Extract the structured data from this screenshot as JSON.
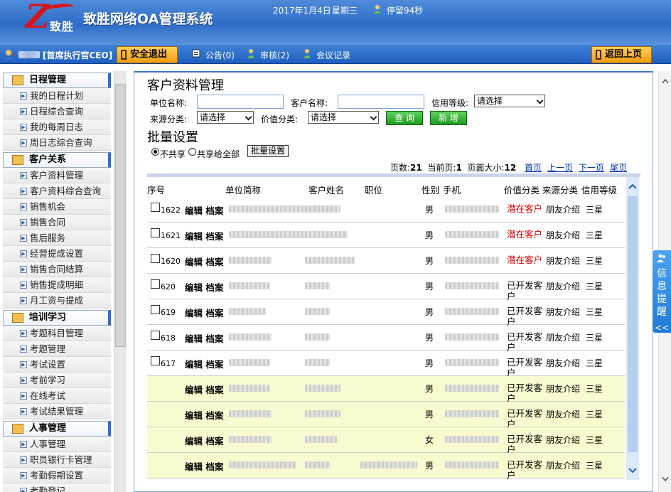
{
  "header": {
    "logo_letter": "Z",
    "logo_text": "致胜",
    "system_title": "致胜网络OA管理系统",
    "date": "2017年1月4日",
    "weekday": "星期三",
    "stay_time": "停留94秒"
  },
  "navbar": {
    "user_role": "[首席执行官CEO]",
    "logout_label": "安全退出",
    "notice_label": "公告(0)",
    "review_label": "审核(2)",
    "meeting_label": "会议记录",
    "back_label": "返回上页"
  },
  "sidebar": {
    "groups": [
      {
        "title": "日程管理",
        "items": [
          "我的日程计划",
          "日程综合查询",
          "我的每周日志",
          "周日志综合查询"
        ]
      },
      {
        "title": "客户关系",
        "items": [
          "客户资料管理",
          "客户资料综合查询",
          "销售机会",
          "销售合同",
          "售后服务",
          "经营提成设置",
          "销售合同结算",
          "销售提成明细",
          "月工资与提成"
        ]
      },
      {
        "title": "培训学习",
        "items": [
          "考题科目管理",
          "考题管理",
          "考试设置",
          "考前学习",
          "在线考试",
          "考试结果管理"
        ]
      },
      {
        "title": "人事管理",
        "items": [
          "人事管理",
          "职员银行卡管理",
          "考勤假期设置",
          "考勤登记"
        ]
      }
    ]
  },
  "page": {
    "title": "客户资料管理",
    "search": {
      "unit_name_label": "单位名称:",
      "unit_name_value": "",
      "customer_name_label": "客户名称:",
      "customer_name_value": "",
      "credit_label": "信用等级:",
      "credit_value": "请选择",
      "source_label": "来源分类:",
      "source_value": "请选择",
      "value_label": "价值分类:",
      "value_value": "请选择",
      "query_button": "查 询",
      "add_button": "新 增"
    },
    "batch": {
      "title": "批量设置",
      "radio_no_share": "不共享",
      "radio_share_all": "共享给全部",
      "button": "批量设置"
    },
    "pager": {
      "pages_label": "页数:",
      "pages_value": "21",
      "current_label": "当前页:",
      "current_value": "1",
      "size_label": "页面大小:",
      "size_value": "12",
      "first": "首页",
      "prev": "上一页",
      "next": "下一页",
      "last": "尾页"
    },
    "table": {
      "headers": [
        "序号",
        "单位简称",
        "客户姓名",
        "职位",
        "性别",
        "手机",
        "价值分类",
        "来源分类",
        "信用等级"
      ],
      "edit_label": "编辑",
      "archive_label": "档案",
      "rows": [
        {
          "id": "1622",
          "sex": "男",
          "value": "潜在客户",
          "source": "朋友介绍",
          "level": "三星",
          "red": true,
          "hl": false
        },
        {
          "id": "1621",
          "sex": "男",
          "value": "潜在客户",
          "source": "朋友介绍",
          "level": "三星",
          "red": true,
          "hl": false
        },
        {
          "id": "1620",
          "sex": "男",
          "value": "潜在客户",
          "source": "朋友介绍",
          "level": "三星",
          "red": true,
          "hl": false
        },
        {
          "id": "620",
          "sex": "男",
          "value": "已开发客户",
          "source": "朋友介绍",
          "level": "三星",
          "red": false,
          "hl": false
        },
        {
          "id": "619",
          "sex": "男",
          "value": "已开发客户",
          "source": "朋友介绍",
          "level": "三星",
          "red": false,
          "hl": false
        },
        {
          "id": "618",
          "sex": "男",
          "value": "已开发客户",
          "source": "朋友介绍",
          "level": "三星",
          "red": false,
          "hl": false
        },
        {
          "id": "617",
          "sex": "男",
          "value": "已开发客户",
          "source": "朋友介绍",
          "level": "三星",
          "red": false,
          "hl": false
        },
        {
          "id": "",
          "sex": "男",
          "value": "已开发客户",
          "source": "朋友介绍",
          "level": "三星",
          "red": false,
          "hl": true
        },
        {
          "id": "",
          "sex": "男",
          "value": "已开发客户",
          "source": "朋友介绍",
          "level": "三星",
          "red": false,
          "hl": true
        },
        {
          "id": "",
          "sex": "女",
          "value": "已开发客户",
          "source": "朋友介绍",
          "level": "三星",
          "red": false,
          "hl": true
        },
        {
          "id": "",
          "sex": "男",
          "value": "已开发客户",
          "source": "朋友介绍",
          "level": "三星",
          "red": false,
          "hl": true
        }
      ]
    }
  },
  "info_tab": {
    "label": "信息提醒",
    "collapse": "<<"
  }
}
